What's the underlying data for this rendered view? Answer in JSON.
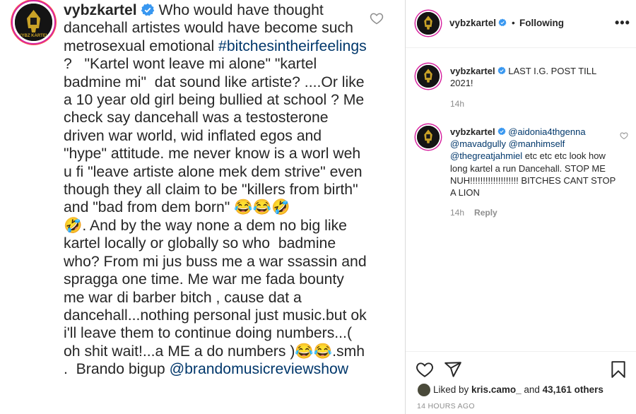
{
  "caption": {
    "username": "vybzkartel",
    "text_part1": " Who would have thought dancehall artistes would have become such metrosexual emotional ",
    "hashtag": "#bitchesintheirfeelings",
    "text_part2": " ?   \"Kartel wont leave mi alone\" \"kartel badmine mi\"  dat sound like artiste? ....Or like a 10 year old girl being bullied at school ? Me check say dancehall was a testosterone driven war world, wid inflated egos and \"hype\" attitude. me never know is a worl weh u fi \"leave artiste alone mek dem strive\" even though they all claim to be \"killers from birth\" and \"bad from dem born\" ",
    "emoji1": "😂😂🤣",
    "emoji2": "🤣",
    "text_part3": ". And by the way none a dem no big like kartel locally or globally so who  badmine who? From mi jus buss me a war ssassin and spragga one time. Me war me fada bounty me war di barber bitch , cause dat a dancehall...nothing personal just music.but ok i'll leave them to continue doing numbers...( oh shit wait!...a ME a do numbers )",
    "emoji3": "😂😂",
    "text_part4": ".smh .  Brando bigup ",
    "mention": "@brandomusicreviewshow"
  },
  "header": {
    "username": "vybzkartel",
    "separator": "•",
    "follow_status": "Following",
    "more": "•••"
  },
  "comments": [
    {
      "username": "vybzkartel",
      "text": "LAST I.G. POST TILL 2021!",
      "time": "14h"
    },
    {
      "username": "vybzkartel",
      "mentions": "@aidonia4thgenna @mavadgully @manhimself @thegreatjahmiel",
      "text": " etc etc etc look how long kartel a run Dancehall. STOP ME NUH!!!!!!!!!!!!!!!!!!! BITCHES CANT STOP A LION",
      "time": "14h",
      "reply": "Reply"
    }
  ],
  "likes": {
    "prefix": "Liked by ",
    "user": "kris.camo_",
    "middle": " and ",
    "count": "43,161 others"
  },
  "timestamp": "14 HOURS AGO",
  "icons": {
    "heart": "heart-icon",
    "share": "share-icon",
    "save": "bookmark-icon",
    "verified": "verified-badge-icon",
    "avatar": "pharaoh-logo-avatar"
  },
  "colors": {
    "link": "#00376b",
    "verified": "#3897f0",
    "muted": "#8e8e8e"
  }
}
